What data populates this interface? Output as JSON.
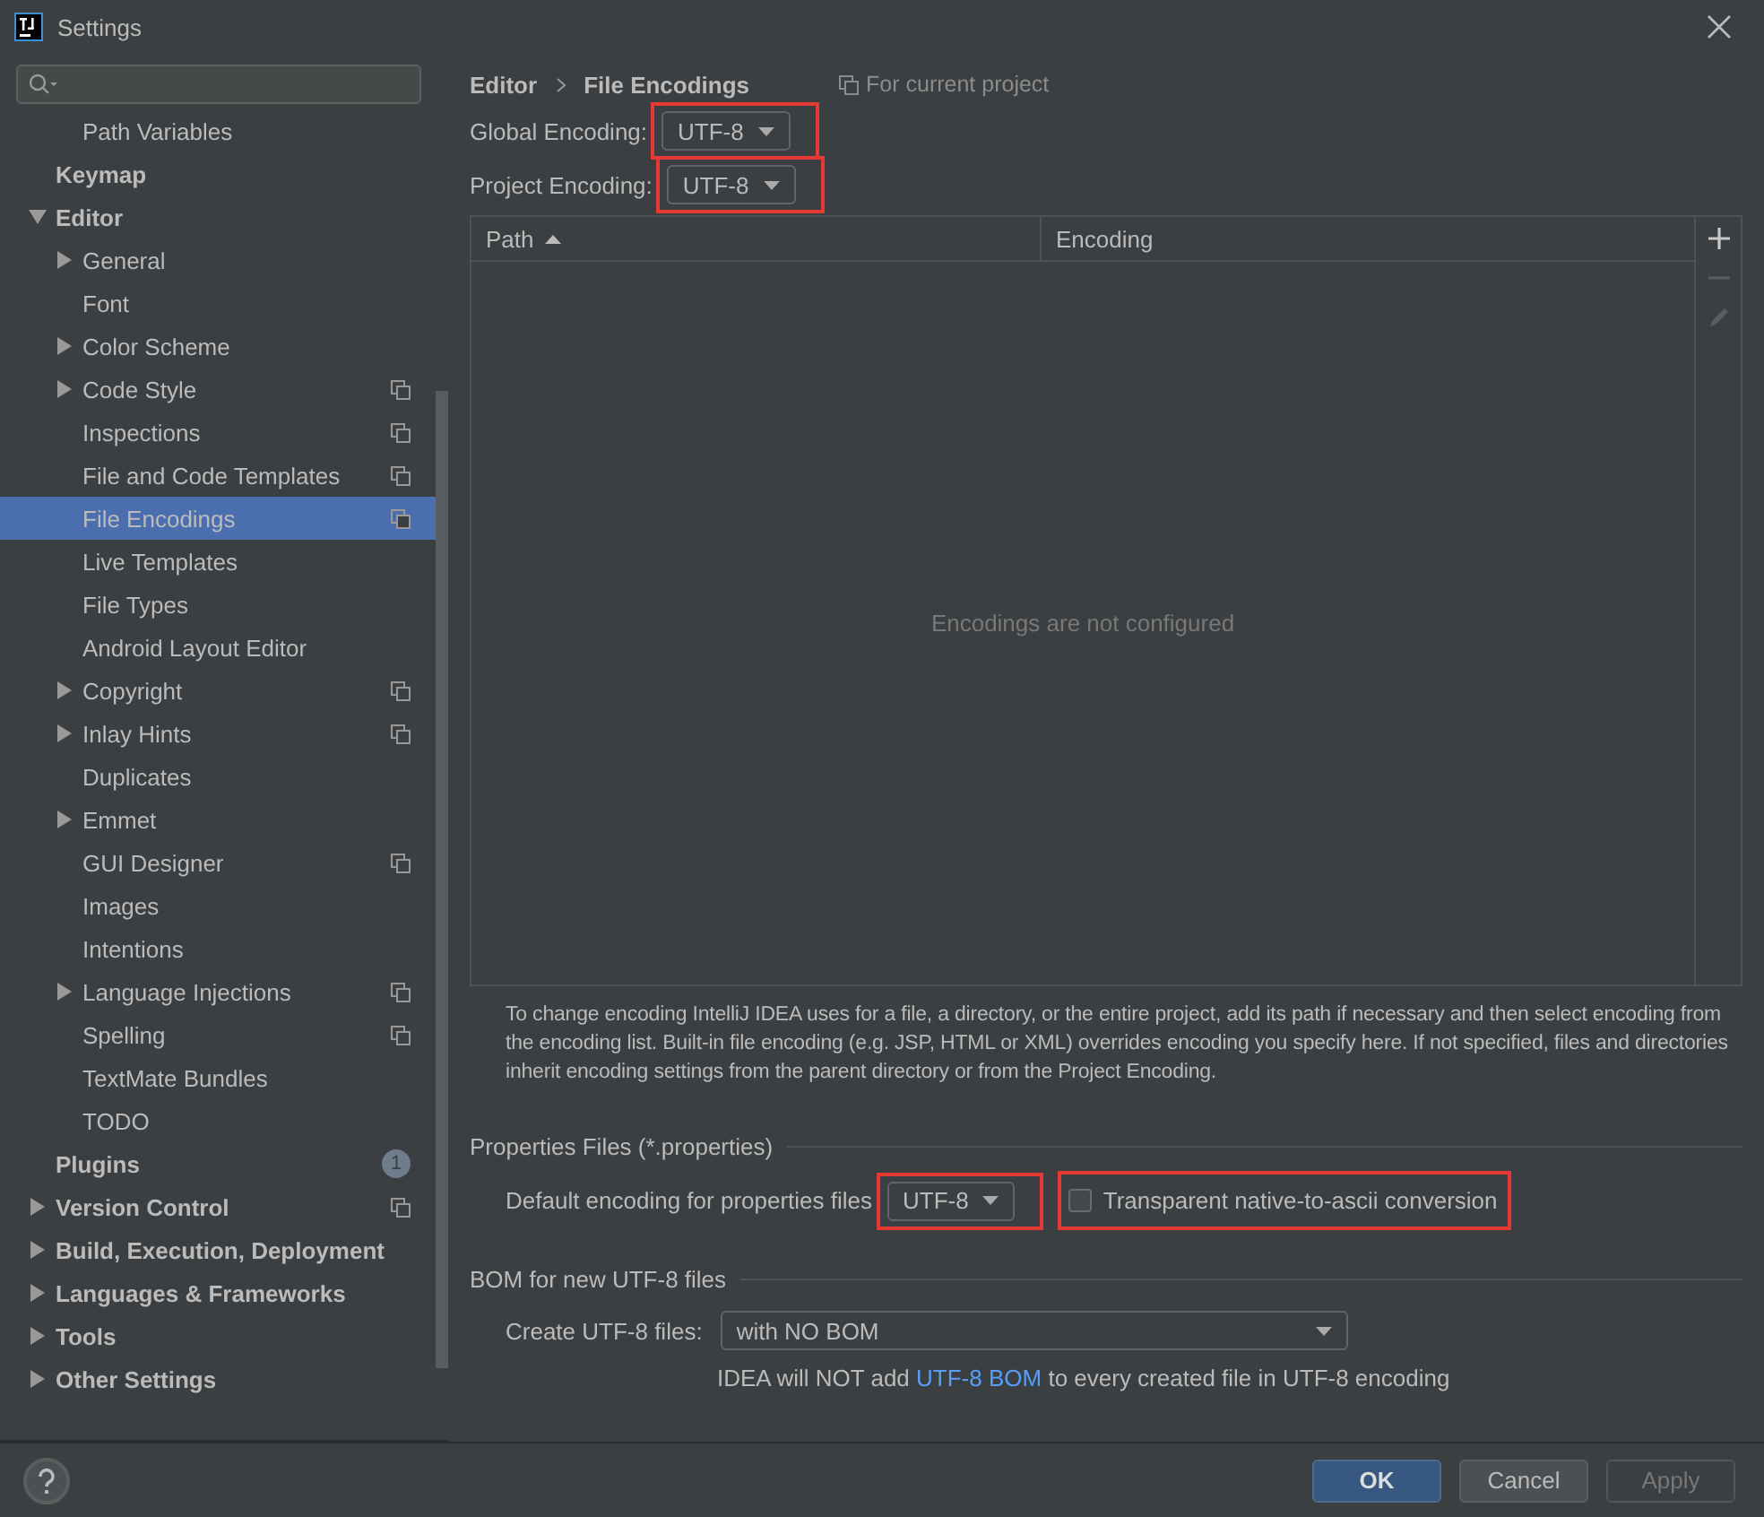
{
  "window": {
    "title": "Settings"
  },
  "sidebar": {
    "scrolled_children": [
      {
        "label": "Path Variables",
        "selected": false
      }
    ],
    "items": [
      {
        "label": "Keymap",
        "expandable": false,
        "selected": false
      },
      {
        "label": "Editor",
        "expandable": true,
        "expanded": true,
        "selected": false,
        "children": [
          {
            "label": "General",
            "expandable": true,
            "expanded": false,
            "selected": false,
            "project_scoped": false
          },
          {
            "label": "Font",
            "expandable": false,
            "selected": false,
            "project_scoped": false
          },
          {
            "label": "Color Scheme",
            "expandable": true,
            "expanded": false,
            "selected": false,
            "project_scoped": false
          },
          {
            "label": "Code Style",
            "expandable": true,
            "expanded": false,
            "selected": false,
            "project_scoped": true
          },
          {
            "label": "Inspections",
            "expandable": false,
            "selected": false,
            "project_scoped": true
          },
          {
            "label": "File and Code Templates",
            "expandable": false,
            "selected": false,
            "project_scoped": true
          },
          {
            "label": "File Encodings",
            "expandable": false,
            "selected": true,
            "project_scoped": true
          },
          {
            "label": "Live Templates",
            "expandable": false,
            "selected": false,
            "project_scoped": false
          },
          {
            "label": "File Types",
            "expandable": false,
            "selected": false,
            "project_scoped": false
          },
          {
            "label": "Android Layout Editor",
            "expandable": false,
            "selected": false,
            "project_scoped": false
          },
          {
            "label": "Copyright",
            "expandable": true,
            "expanded": false,
            "selected": false,
            "project_scoped": true
          },
          {
            "label": "Inlay Hints",
            "expandable": true,
            "expanded": false,
            "selected": false,
            "project_scoped": true
          },
          {
            "label": "Duplicates",
            "expandable": false,
            "selected": false,
            "project_scoped": false
          },
          {
            "label": "Emmet",
            "expandable": true,
            "expanded": false,
            "selected": false,
            "project_scoped": false
          },
          {
            "label": "GUI Designer",
            "expandable": false,
            "selected": false,
            "project_scoped": true
          },
          {
            "label": "Images",
            "expandable": false,
            "selected": false,
            "project_scoped": false
          },
          {
            "label": "Intentions",
            "expandable": false,
            "selected": false,
            "project_scoped": false
          },
          {
            "label": "Language Injections",
            "expandable": true,
            "expanded": false,
            "selected": false,
            "project_scoped": true
          },
          {
            "label": "Spelling",
            "expandable": false,
            "selected": false,
            "project_scoped": true
          },
          {
            "label": "TextMate Bundles",
            "expandable": false,
            "selected": false,
            "project_scoped": false
          },
          {
            "label": "TODO",
            "expandable": false,
            "selected": false,
            "project_scoped": false
          }
        ]
      },
      {
        "label": "Plugins",
        "expandable": false,
        "selected": false,
        "badge": "1"
      },
      {
        "label": "Version Control",
        "expandable": true,
        "expanded": false,
        "selected": false,
        "project_scoped": true
      },
      {
        "label": "Build, Execution, Deployment",
        "expandable": true,
        "expanded": false,
        "selected": false
      },
      {
        "label": "Languages & Frameworks",
        "expandable": true,
        "expanded": false,
        "selected": false
      },
      {
        "label": "Tools",
        "expandable": true,
        "expanded": false,
        "selected": false
      },
      {
        "label": "Other Settings",
        "expandable": true,
        "expanded": false,
        "selected": false
      }
    ]
  },
  "breadcrumb": [
    "Editor",
    "File Encodings"
  ],
  "scope_note": "For current project",
  "global_encoding": {
    "label": "Global Encoding:",
    "value": "UTF-8",
    "highlighted": true
  },
  "project_encoding": {
    "label": "Project Encoding:",
    "value": "UTF-8",
    "highlighted": true
  },
  "table": {
    "columns": [
      {
        "label": "Path",
        "sorted": true
      },
      {
        "label": "Encoding",
        "sorted": false
      }
    ],
    "empty_text": "Encodings are not configured",
    "toolbar": [
      {
        "kind": "add",
        "disabled": false
      },
      {
        "kind": "remove",
        "disabled": true
      },
      {
        "kind": "edit",
        "disabled": true
      }
    ]
  },
  "description": "To change encoding IntelliJ IDEA uses for a file, a directory, or the entire project, add its path if necessary and then select encoding from the encoding list. Built-in file encoding (e.g. JSP, HTML or XML) overrides encoding you specify here. If not specified, files and directories inherit encoding settings from the parent directory or from the Project Encoding.",
  "properties": {
    "title": "Properties Files (*.properties)",
    "label": "Default encoding for properties files",
    "value": "UTF-8",
    "highlighted": true,
    "native_to_ascii": {
      "label": "Transparent native-to-ascii conversion",
      "checked": false,
      "highlighted": true
    }
  },
  "bom": {
    "title": "BOM for new UTF-8 files",
    "label": "Create UTF-8 files:",
    "value": "with NO BOM",
    "note_before": "IDEA will NOT add ",
    "note_link": "UTF-8 BOM",
    "note_after": " to every created file in UTF-8 encoding"
  },
  "buttons": [
    {
      "label": "OK",
      "kind": "default",
      "disabled": false
    },
    {
      "label": "Cancel",
      "kind": "normal",
      "disabled": false
    },
    {
      "label": "Apply",
      "kind": "normal",
      "disabled": true
    }
  ]
}
